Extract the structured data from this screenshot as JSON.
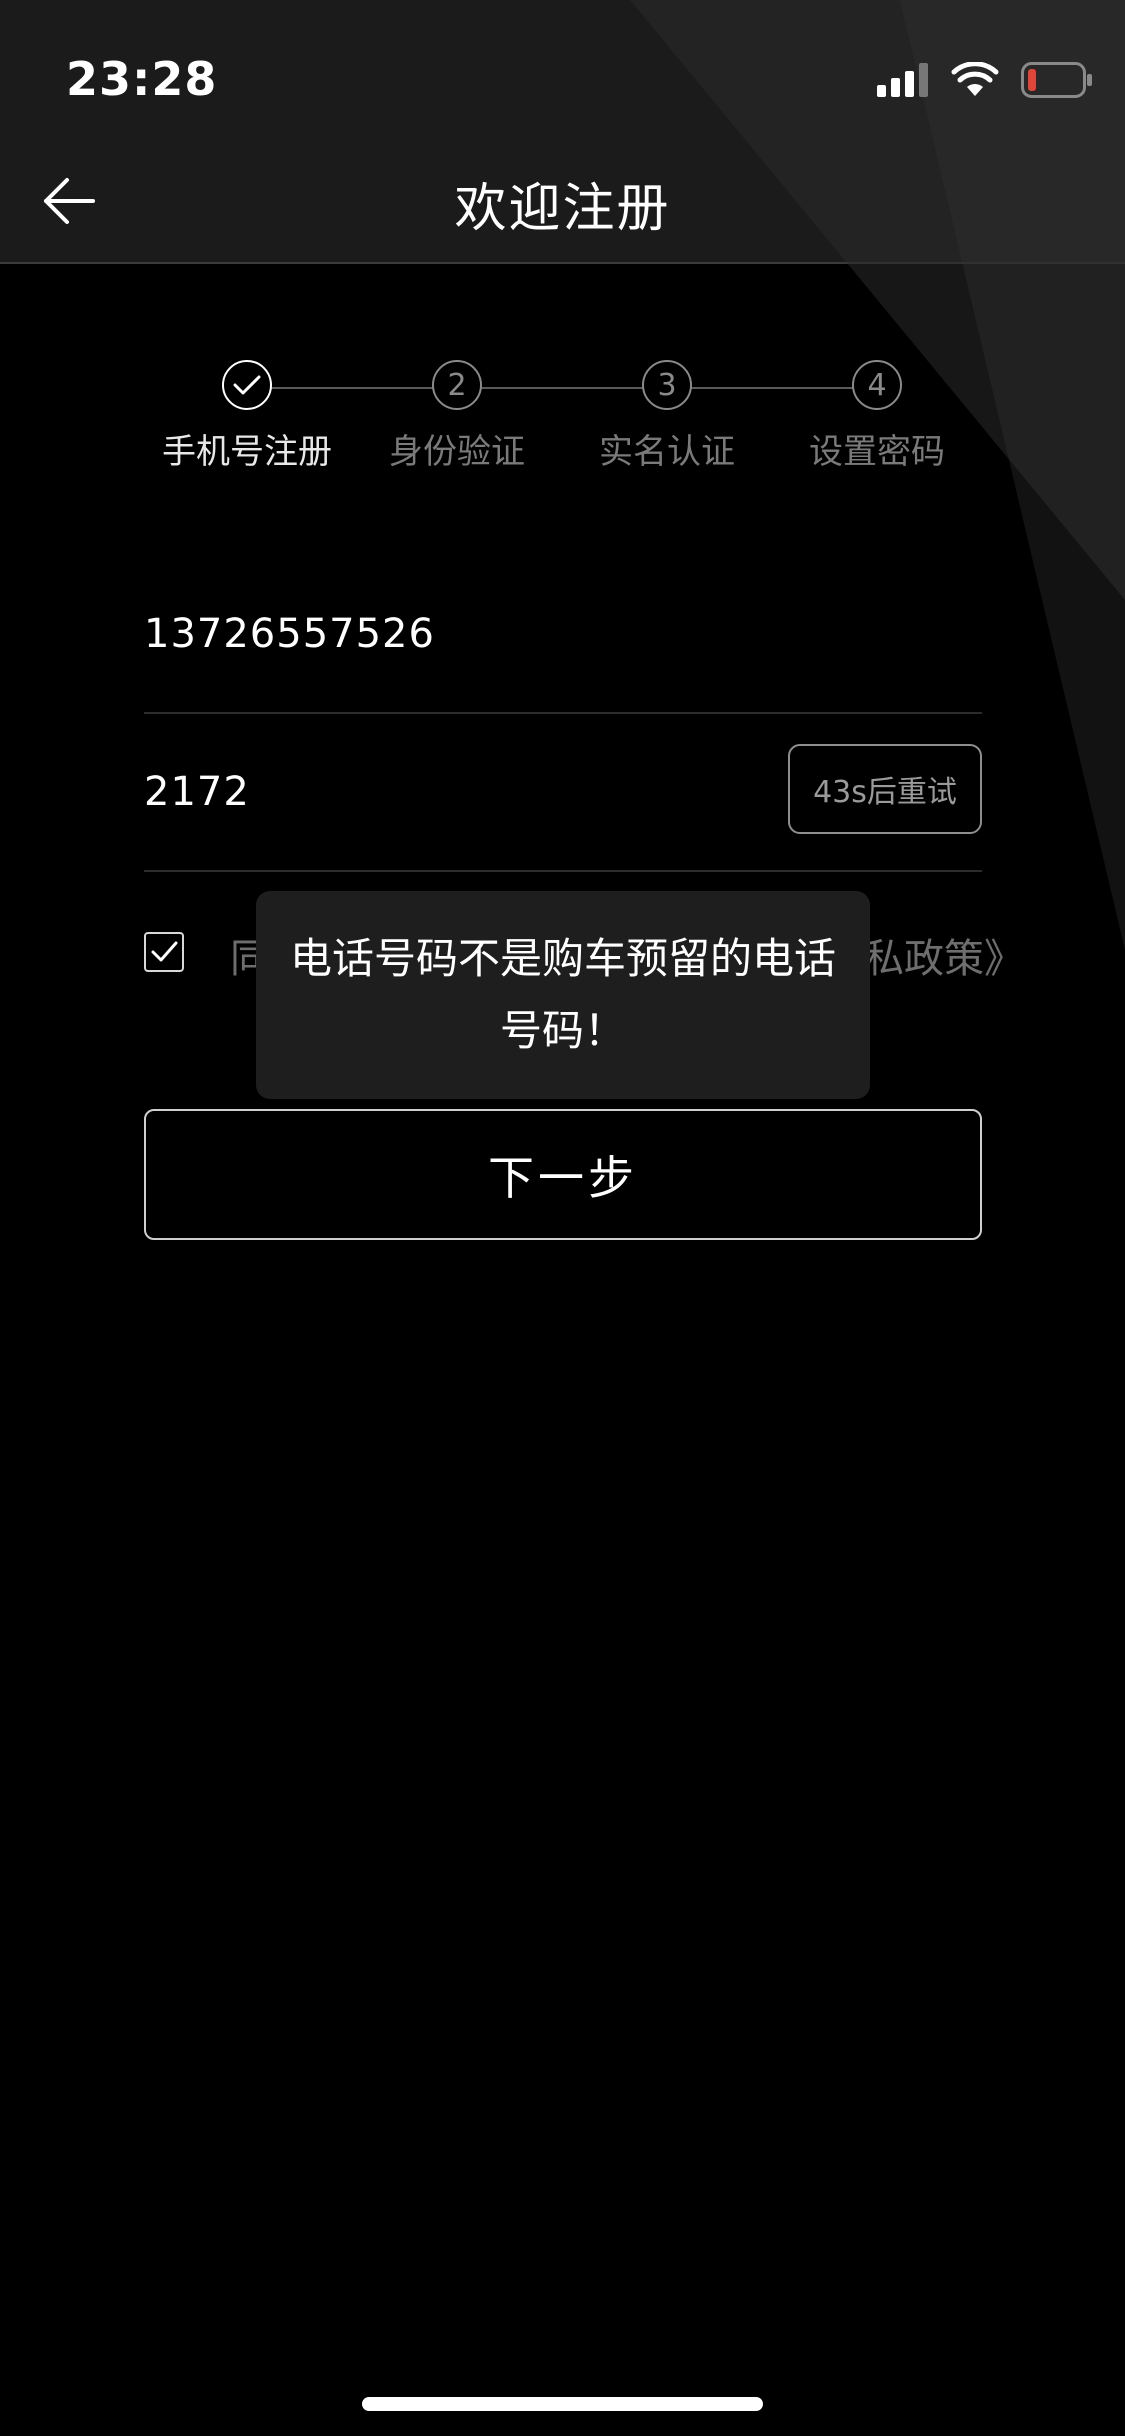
{
  "status_bar": {
    "time": "23:28",
    "icons": [
      "cellular-signal-icon",
      "wifi-icon",
      "battery-low-icon"
    ],
    "battery_color": "#e0453a"
  },
  "nav": {
    "title": "欢迎注册",
    "back_icon": "arrow-left-icon"
  },
  "stepper": {
    "steps": [
      {
        "marker": "",
        "label": "手机号注册",
        "state": "completed"
      },
      {
        "marker": "2",
        "label": "身份验证",
        "state": "pending"
      },
      {
        "marker": "3",
        "label": "实名认证",
        "state": "pending"
      },
      {
        "marker": "4",
        "label": "设置密码",
        "state": "pending"
      }
    ]
  },
  "form": {
    "phone_value": "13726557526",
    "code_value": "2172",
    "retry_label": "43s后重试",
    "agree_checked": true,
    "agree_text_visible": "同",
    "agree_link_visible": "私政策》",
    "next_label": "下一步"
  },
  "toast": {
    "message": "电话号码不是购车预留的电话号码！"
  },
  "colors": {
    "background": "#000000",
    "header_band": "#1b1b1b",
    "muted_text": "#7a7a7a",
    "toast_bg": "#1e1e1e"
  }
}
